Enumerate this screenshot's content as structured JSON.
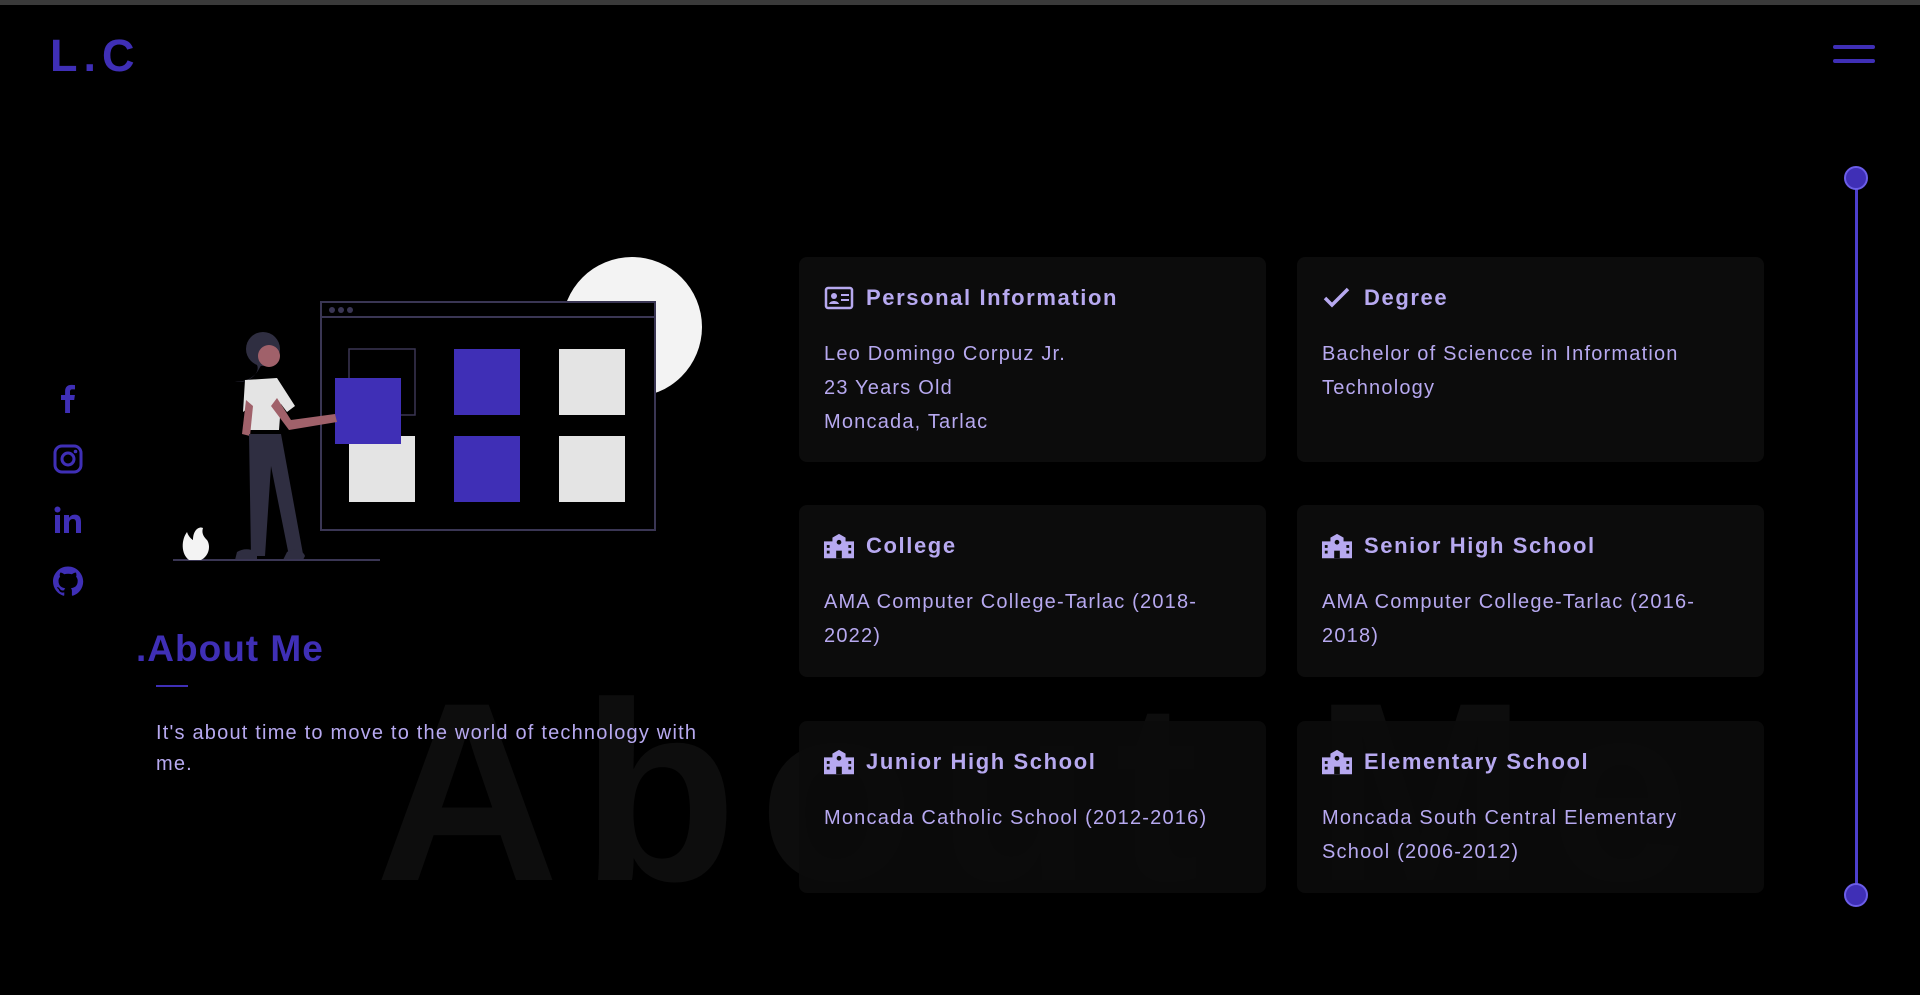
{
  "header": {
    "logo": "L.C",
    "menu_icon": "hamburger-menu-icon"
  },
  "colors": {
    "accent": "#3f2fb6",
    "text": "#b7a9f0",
    "card_bg": "#0c0c0c",
    "background": "#000000"
  },
  "social": [
    {
      "name": "facebook-icon"
    },
    {
      "name": "instagram-icon"
    },
    {
      "name": "linkedin-icon"
    },
    {
      "name": "github-icon"
    }
  ],
  "about": {
    "title": "About Me",
    "text": "It's about time to move to the world of technology with me.",
    "watermark": "About Me"
  },
  "cards": [
    {
      "icon": "id-card-icon",
      "title": "Personal Information",
      "lines": [
        "Leo Domingo Corpuz Jr.",
        "23 Years Old",
        "Moncada, Tarlac"
      ]
    },
    {
      "icon": "check-icon",
      "title": "Degree",
      "lines": [
        "Bachelor of Sciencce in Information Technology"
      ]
    },
    {
      "icon": "school-icon",
      "title": "College",
      "lines": [
        "AMA Computer College-Tarlac (2018-2022)"
      ]
    },
    {
      "icon": "school-icon",
      "title": "Senior High School",
      "lines": [
        "AMA Computer College-Tarlac (2016-2018)"
      ]
    },
    {
      "icon": "school-icon",
      "title": "Junior High School",
      "lines": [
        "Moncada Catholic School (2012-2016)"
      ]
    },
    {
      "icon": "school-icon",
      "title": "Elementary School",
      "lines": [
        "Moncada South Central Elementary School (2006-2012)"
      ]
    }
  ]
}
